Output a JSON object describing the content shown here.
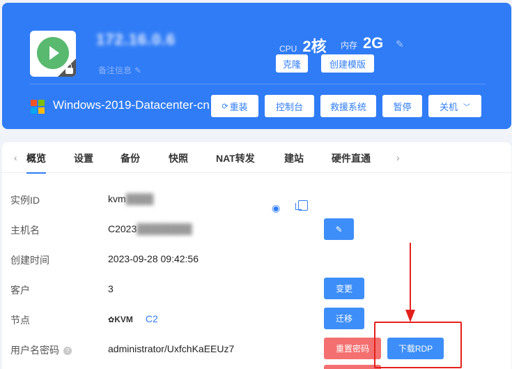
{
  "header": {
    "ip": "172.16.0.6",
    "remark": "备注信息",
    "cpu_label": "CPU",
    "cpu_value": "2核",
    "mem_label": "内存",
    "mem_value": "2G",
    "clone_label": "克隆",
    "template_label": "创建模版",
    "os_name": "Windows-2019-Datacenter-cn",
    "actions": {
      "reinstall": "重装",
      "console": "控制台",
      "rescue": "救援系统",
      "pause": "暂停",
      "shutdown": "关机"
    }
  },
  "tabs": [
    "概览",
    "设置",
    "备份",
    "快照",
    "NAT转发",
    "建站",
    "硬件直通"
  ],
  "info": {
    "instance_id_label": "实例ID",
    "instance_id_value": "kvm",
    "hostname_label": "主机名",
    "hostname_value": "C2023",
    "created_label": "创建时间",
    "created_value": "2023-09-28 09:42:56",
    "client_label": "客户",
    "client_value": "3",
    "node_label": "节点",
    "node_kvm": "KVM",
    "node_value": "C2",
    "credentials_label": "用户名密码",
    "credentials_value": "administrator/UxfchKaEEUz7"
  },
  "buttons": {
    "change": "变更",
    "migrate": "迁移",
    "reset_password": "重置密码",
    "download_rdp": "下载RDP"
  },
  "colors": {
    "primary": "#2f7cf6",
    "danger": "#f47070",
    "running": "#58b96f",
    "annotation": "#e3201b"
  }
}
